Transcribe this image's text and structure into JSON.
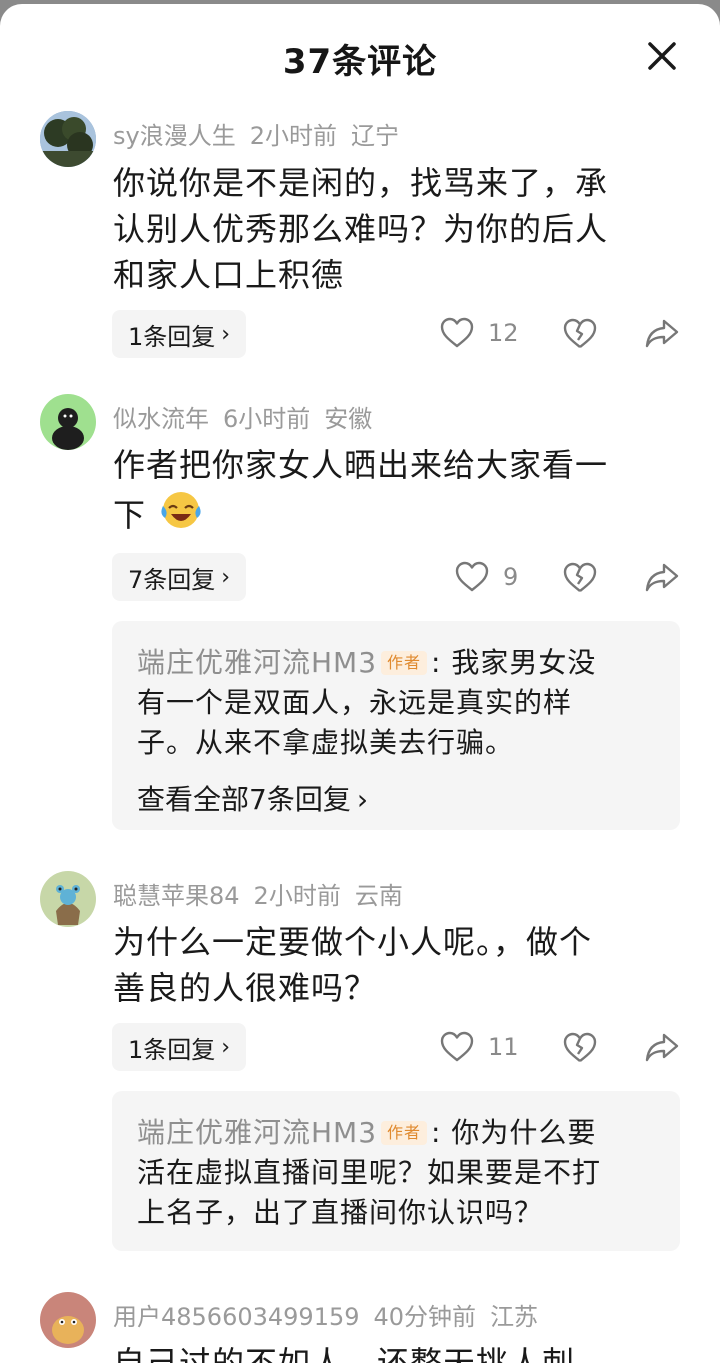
{
  "header": {
    "title": "37条评论"
  },
  "comments": [
    {
      "user": "sy浪漫人生",
      "time": "2小时前",
      "location": "辽宁",
      "lines": [
        "你说你是不是闲的，找骂来了，承",
        "认别人优秀那么难吗？为你的后人",
        "和家人口上积德"
      ],
      "reply_label": "1条回复",
      "likes": "12"
    },
    {
      "user": "似水流年",
      "time": "6小时前",
      "location": "安徽",
      "lines": [
        "作者把你家女人晒出来给大家看一",
        "下"
      ],
      "reply_label": "7条回复",
      "likes": "9",
      "sub_reply": {
        "name": "端庄优雅河流HM3",
        "tag": "作者",
        "lines": [
          ": 我家男女没",
          "有一个是双面人，永远是真实的样",
          "子。从来不拿虚拟美去行骗。"
        ],
        "view_all": "查看全部7条回复"
      }
    },
    {
      "user": "聪慧苹果84",
      "time": "2小时前",
      "location": "云南",
      "lines": [
        "为什么一定要做个小人呢。，做个",
        "善良的人很难吗？"
      ],
      "reply_label": "1条回复",
      "likes": "11",
      "sub_reply": {
        "name": "端庄优雅河流HM3",
        "tag": "作者",
        "lines": [
          ": 你为什么要",
          "活在虚拟直播间里呢？如果要是不打",
          "上名子，出了直播间你认识吗？"
        ]
      }
    },
    {
      "user": "用户4856603499159",
      "time": "40分钟前",
      "location": "江苏",
      "lines": [
        "自己过的不如人，还整天挑人刺，"
      ]
    }
  ],
  "icons": {
    "close": "close-icon",
    "like": "heart-outline-icon",
    "dislike": "broken-heart-icon",
    "share": "share-arrow-icon",
    "chevron": "chevron-right-icon",
    "emoji": "laughing-tears-emoji"
  },
  "colors": {
    "author_tag_bg": "#fdeedd",
    "author_tag_text": "#e08a2f",
    "meta": "#9a9a9a"
  }
}
